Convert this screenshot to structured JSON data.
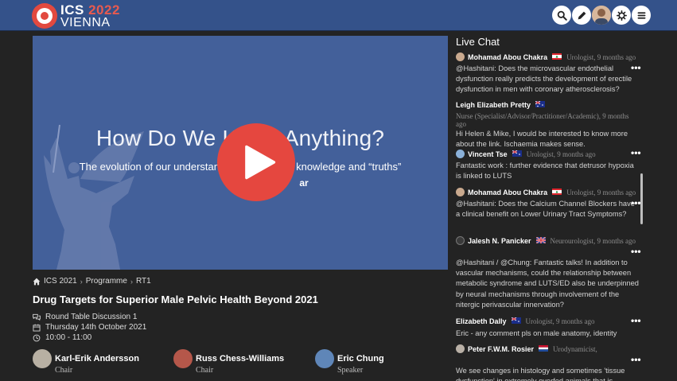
{
  "header": {
    "logo_line1": "ICS",
    "logo_year": "2022",
    "logo_line2": "VIENNA",
    "icons": [
      "search-icon",
      "pencil-icon",
      "user-avatar",
      "settings-icon",
      "menu-icon"
    ]
  },
  "video": {
    "slide_title": "How Do We Know Anything?",
    "slide_subtitle": "The evolution of our understanding of scientific knowledge and “truths”",
    "slide_author": "ar"
  },
  "breadcrumb": [
    "ICS 2021",
    "Programme",
    "RT1"
  ],
  "session": {
    "title": "Drug Targets for Superior Male Pelvic Health Beyond 2021",
    "type": "Round Table Discussion 1",
    "date": "Thursday 14th October 2021",
    "time": "10:00 - 11:00"
  },
  "speakers": [
    {
      "name": "Karl-Erik Andersson",
      "role": "Chair"
    },
    {
      "name": "Russ Chess-Williams",
      "role": "Chair"
    },
    {
      "name": "Eric Chung",
      "role": "Speaker"
    }
  ],
  "chat": {
    "heading": "Live Chat",
    "messages": [
      {
        "name": "Mohamad Abou Chakra",
        "flag": "lebanon",
        "meta": "Urologist, 9 months ago",
        "text": "@Hashitani: Does the microvascular endothelial dysfunction really predicts the development of erectile dysfunction in men with coronary atherosclerosis?"
      },
      {
        "name": "Leigh Elizabeth Pretty",
        "flag": "australia",
        "meta": "Nurse (Specialist/Advisor/Practitioner/Academic), 9 months ago",
        "text": "Hi Helen & Mike, I would be interested to know more about the link. Ischaemia makes sense."
      },
      {
        "name": "Vincent Tse",
        "flag": "australia",
        "meta": "Urologist, 9 months ago",
        "text": "Fantastic work : further evidence that detrusor hypoxia is linked to LUTS"
      },
      {
        "name": "Mohamad Abou Chakra",
        "flag": "lebanon",
        "meta": "Urologist, 9 months ago",
        "text": "@Hashitani: Does the Calcium Channel Blockers have a clinical benefit on Lower Urinary Tract Symptoms?"
      },
      {
        "name": "Jalesh N. Panicker",
        "flag": "uk",
        "meta": "Neurourologist, 9 months ago",
        "text": "@Hashitani / @Chung: Fantastic talks! In addition to vascular mechanisms, could the relationship between metabolic syndrome and LUTS/ED also be underpinned by neural mechanisms through involvement of the nitergic perivascular innervation?"
      },
      {
        "name": "Elizabeth Dally",
        "flag": "australia",
        "meta": "Urologist, 9 months ago",
        "text": "Eric - any comment pls on male anatomy, identity"
      },
      {
        "name": "Peter F.W.M. Rosier",
        "flag": "netherlands",
        "meta": "Urodynamicist,",
        "text": "We see changes in histology and sometimes 'tissue dysfunction' in extremely overfed animals that is"
      }
    ],
    "more_label": "•••"
  },
  "colors": {
    "header_bg": "#34528a",
    "page_bg": "#232323",
    "slide_bg": "#43609a",
    "accent_red": "#e5473f"
  }
}
